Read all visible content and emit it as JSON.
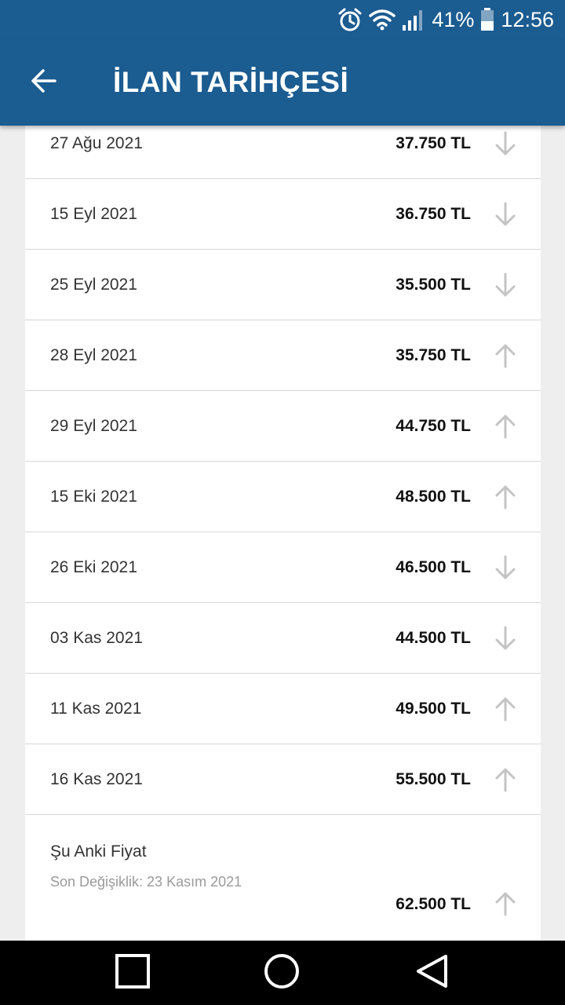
{
  "status_bar": {
    "battery": "41%",
    "time": "12:56"
  },
  "app_bar": {
    "title": "İLAN TARİHÇESİ"
  },
  "history": [
    {
      "date": "27 Ağu 2021",
      "price": "37.750 TL",
      "direction": "down"
    },
    {
      "date": "15 Eyl 2021",
      "price": "36.750 TL",
      "direction": "down"
    },
    {
      "date": "25 Eyl 2021",
      "price": "35.500 TL",
      "direction": "down"
    },
    {
      "date": "28 Eyl 2021",
      "price": "35.750 TL",
      "direction": "up"
    },
    {
      "date": "29 Eyl 2021",
      "price": "44.750 TL",
      "direction": "up"
    },
    {
      "date": "15 Eki 2021",
      "price": "48.500 TL",
      "direction": "up"
    },
    {
      "date": "26 Eki 2021",
      "price": "46.500 TL",
      "direction": "down"
    },
    {
      "date": "03 Kas 2021",
      "price": "44.500 TL",
      "direction": "down"
    },
    {
      "date": "11 Kas 2021",
      "price": "49.500 TL",
      "direction": "up"
    },
    {
      "date": "16 Kas 2021",
      "price": "55.500 TL",
      "direction": "up"
    }
  ],
  "current": {
    "label": "Şu Anki Fiyat",
    "last_change": "Son Değişiklik: 23 Kasım 2021",
    "price": "62.500 TL",
    "direction": "up"
  },
  "colors": {
    "primary": "#1b5c91",
    "arrow": "#c4c4c4"
  }
}
